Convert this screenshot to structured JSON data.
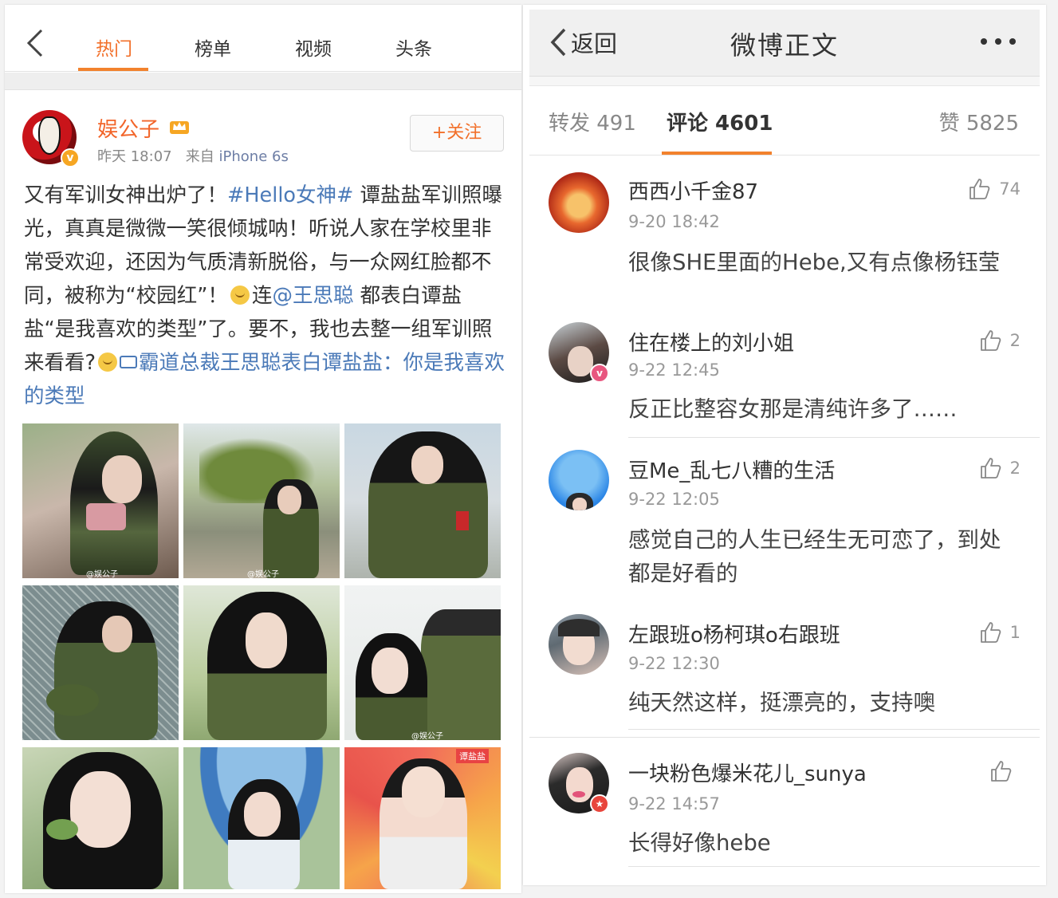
{
  "left": {
    "tabs": [
      "热门",
      "榜单",
      "视频",
      "头条"
    ],
    "active_tab": "热门",
    "post": {
      "author": "娱公子",
      "time": "昨天 18:07",
      "source_prefix": "来自",
      "source": "iPhone 6s",
      "follow_label": "+关注",
      "text": {
        "p1": "又有军训女神出炉了！",
        "hashtag": "#Hello女神#",
        "p2": " 谭盐盐军训照曝光，真真是微微一笑很倾城呐！听说人家在学校里非常受欢迎，还因为气质清新脱俗，与一众网红脸都不同，被称为“校园红”！",
        "p3": "连",
        "mention": "@王思聪",
        "p4": " 都表白谭盐盐“是我喜欢的类型”了。要不，我也去整一组军训照来看看?",
        "video_link": "霸道总裁王思聪表白谭盐盐：你是我喜欢的类型"
      },
      "photo_watermarks": [
        "@娱公子",
        "@娱公子",
        "@娱公子"
      ],
      "last_photo_tag": "谭盐盐"
    }
  },
  "right": {
    "back_label": "返回",
    "title": "微博正文",
    "stats": {
      "repost_label": "转发 491",
      "comment_label": "评论 4601",
      "like_label": "赞 5825"
    },
    "comments": [
      {
        "name": "西西小千金87",
        "time": "9-20 18:42",
        "text": "很像SHE里面的Hebe,又有点像杨钰莹",
        "likes": "74"
      },
      {
        "name": "住在楼上的刘小姐",
        "time": "9-22 12:45",
        "text": "反正比整容女那是清纯许多了……",
        "likes": "2"
      },
      {
        "name": "豆Me_乱七八糟的生活",
        "time": "9-22 12:05",
        "text": "感觉自己的人生已经生无可恋了，到处都是好看的",
        "likes": "2"
      },
      {
        "name": "左跟班o杨柯琪o右跟班",
        "time": "9-22 12:30",
        "text": "纯天然这样，挺漂亮的，支持噢",
        "likes": "1"
      },
      {
        "name": "一块粉色爆米花儿_sunya",
        "time": "9-22 14:57",
        "text": "长得好像hebe",
        "likes": ""
      }
    ]
  },
  "colors": {
    "accent": "#f2702a",
    "link": "#4b7ab8",
    "muted": "#999999"
  }
}
